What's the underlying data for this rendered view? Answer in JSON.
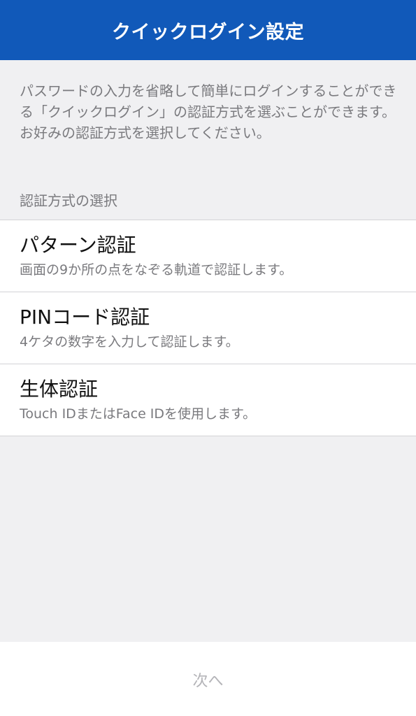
{
  "header": {
    "title": "クイックログイン設定"
  },
  "description": "パスワードの入力を省略して簡単にログインすることができる「クイックログイン」の認証方式を選ぶことができます。お好みの認証方式を選択してください。",
  "section_label": "認証方式の選択",
  "options": [
    {
      "title": "パターン認証",
      "description": "画面の9か所の点をなぞる軌道で認証します。"
    },
    {
      "title": "PINコード認証",
      "description": "4ケタの数字を入力して認証します。"
    },
    {
      "title": "生体認証",
      "description": "Touch IDまたはFace IDを使用します。"
    }
  ],
  "footer": {
    "next_label": "次へ"
  },
  "colors": {
    "header_bg": "#1159b9",
    "page_bg": "#f0f0f2",
    "disabled_text": "#b4b4b8"
  }
}
